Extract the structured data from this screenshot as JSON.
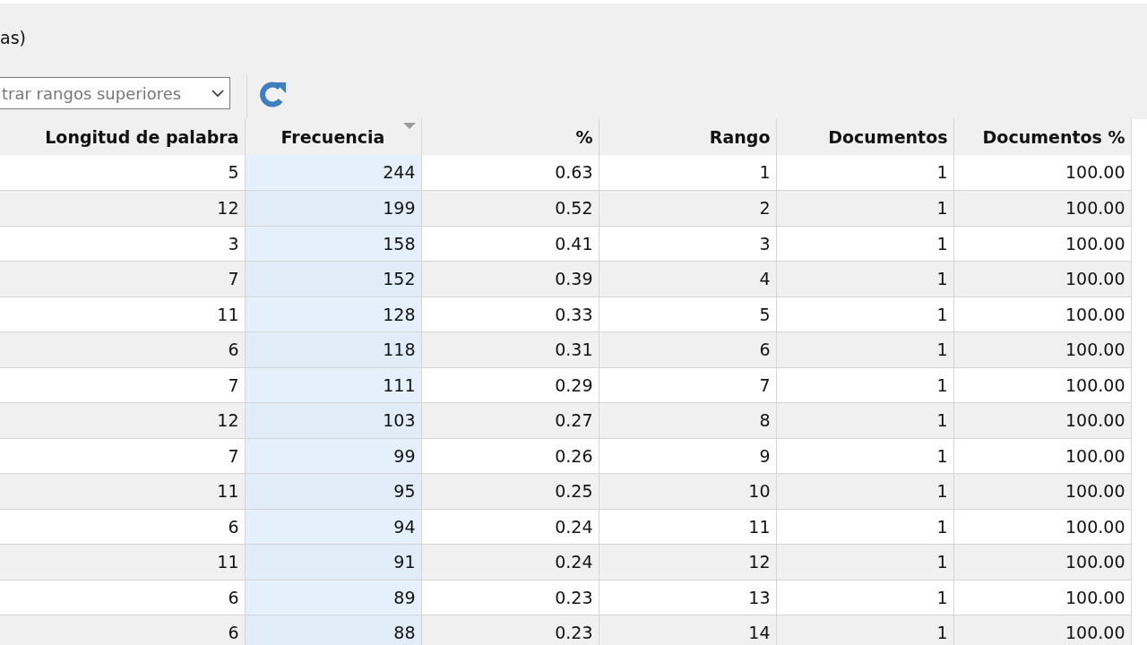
{
  "toolbar": {
    "label": "as)",
    "range_select": {
      "value": "trar rangos superiores"
    }
  },
  "table": {
    "columns": [
      {
        "label": "Longitud de palabra",
        "sorted": false
      },
      {
        "label": "Frecuencia",
        "sorted": true
      },
      {
        "label": "%",
        "sorted": false
      },
      {
        "label": "Rango",
        "sorted": false
      },
      {
        "label": "Documentos",
        "sorted": false
      },
      {
        "label": "Documentos %",
        "sorted": false
      }
    ],
    "rows": [
      [
        "5",
        "244",
        "0.63",
        "1",
        "1",
        "100.00"
      ],
      [
        "12",
        "199",
        "0.52",
        "2",
        "1",
        "100.00"
      ],
      [
        "3",
        "158",
        "0.41",
        "3",
        "1",
        "100.00"
      ],
      [
        "7",
        "152",
        "0.39",
        "4",
        "1",
        "100.00"
      ],
      [
        "11",
        "128",
        "0.33",
        "5",
        "1",
        "100.00"
      ],
      [
        "6",
        "118",
        "0.31",
        "6",
        "1",
        "100.00"
      ],
      [
        "7",
        "111",
        "0.29",
        "7",
        "1",
        "100.00"
      ],
      [
        "12",
        "103",
        "0.27",
        "8",
        "1",
        "100.00"
      ],
      [
        "7",
        "99",
        "0.26",
        "9",
        "1",
        "100.00"
      ],
      [
        "11",
        "95",
        "0.25",
        "10",
        "1",
        "100.00"
      ],
      [
        "6",
        "94",
        "0.24",
        "11",
        "1",
        "100.00"
      ],
      [
        "11",
        "91",
        "0.24",
        "12",
        "1",
        "100.00"
      ],
      [
        "6",
        "89",
        "0.23",
        "13",
        "1",
        "100.00"
      ],
      [
        "6",
        "88",
        "0.23",
        "14",
        "1",
        "100.00"
      ]
    ]
  }
}
